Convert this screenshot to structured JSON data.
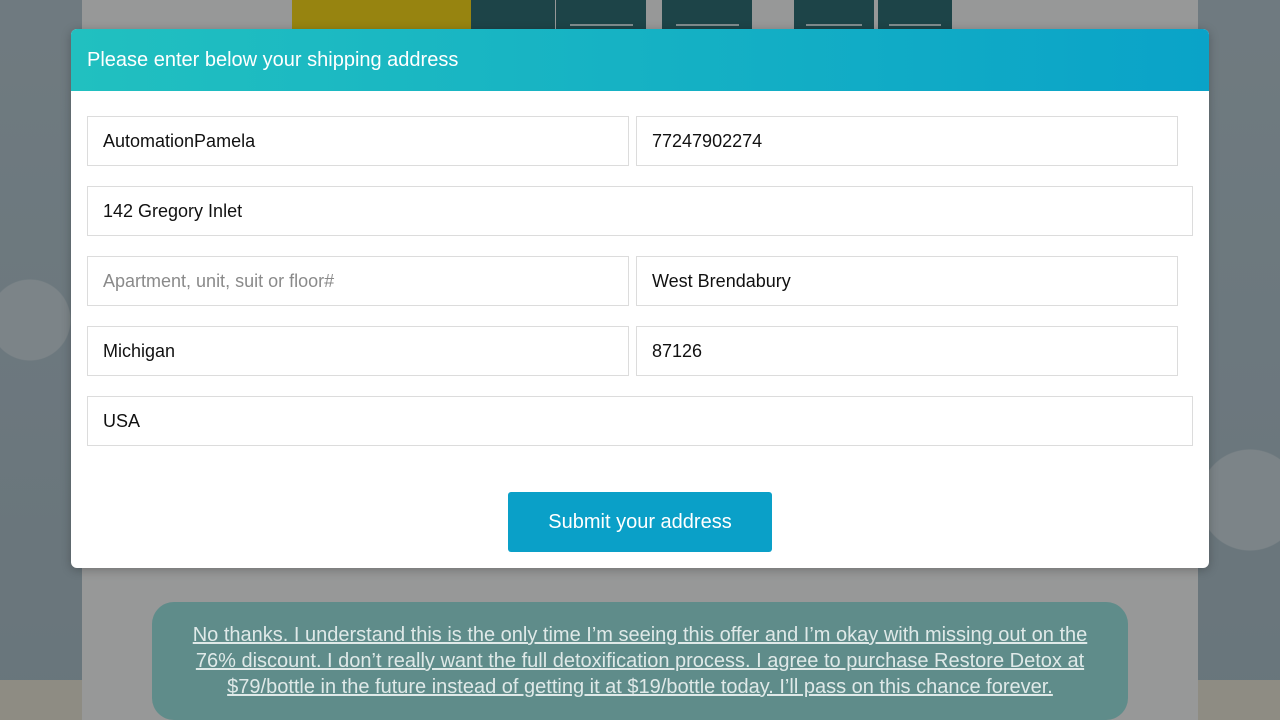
{
  "modal": {
    "title": "Please enter below your shipping address",
    "fields": {
      "full_name": {
        "value": "AutomationPamela",
        "placeholder": ""
      },
      "phone": {
        "value": "77247902274",
        "placeholder": ""
      },
      "street": {
        "value": "142 Gregory Inlet",
        "placeholder": ""
      },
      "apartment": {
        "value": "",
        "placeholder": "Apartment, unit, suit or floor#"
      },
      "city": {
        "value": "West Brendabury",
        "placeholder": ""
      },
      "state": {
        "value": "Michigan",
        "placeholder": ""
      },
      "zip": {
        "value": "87126",
        "placeholder": ""
      },
      "country": {
        "value": "USA",
        "placeholder": ""
      }
    },
    "submit_label": "Submit your address"
  },
  "page": {
    "decline_text": "No thanks. I understand this is the only time I’m seeing this offer and I’m okay with missing out on the 76% discount. I don’t really want the full detoxification process. I agree to purchase Restore Detox at $79/bottle in the future instead of getting it at $19/bottle today. I’ll pass on this chance forever."
  },
  "colors": {
    "header_gradient_start": "#21c0c0",
    "header_gradient_end": "#0aa3c8",
    "submit_button": "#0aa0c8",
    "decline_box": "#5f8c8a"
  }
}
